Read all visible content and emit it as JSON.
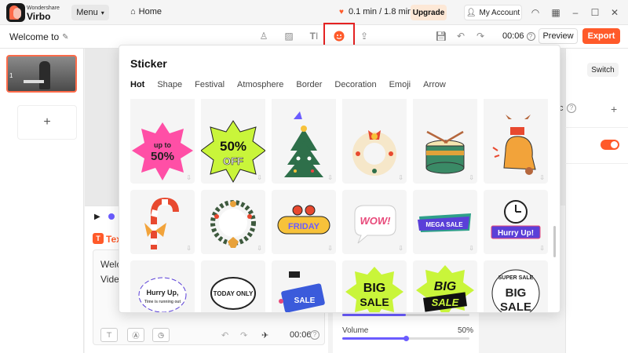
{
  "app": {
    "brand_small": "Wondershare",
    "brand_name": "Virbo",
    "menu_label": "Menu",
    "home_label": "Home",
    "credits": "0.1 min / 1.8 min",
    "upgrade_label": "Upgrade",
    "account_label": "My Account"
  },
  "project": {
    "title": "Welcome to"
  },
  "toolbar": {
    "time": "00:06",
    "preview_label": "Preview",
    "export_label": "Export"
  },
  "slides": [
    {
      "number": "1"
    }
  ],
  "right_panel": {
    "switch_label": "Switch",
    "clipped_text": "c"
  },
  "script": {
    "tab_label": "Tex",
    "line1": "Welco",
    "line2": "Vide",
    "time": "00:06"
  },
  "voice": {
    "volume_label": "Volume",
    "volume_value": "50%",
    "volume_level": 0.5,
    "speed_level": 0.5
  },
  "sticker": {
    "title": "Sticker",
    "tabs": [
      "Hot",
      "Shape",
      "Festival",
      "Atmosphere",
      "Border",
      "Decoration",
      "Emoji",
      "Arrow"
    ],
    "active_tab": "Hot",
    "items": [
      {
        "name": "up-to-50-sticker",
        "l1": "up to",
        "l2": "50%"
      },
      {
        "name": "50-off-sticker",
        "l1": "50%",
        "l2": "OFF"
      },
      {
        "name": "christmas-tree-sticker"
      },
      {
        "name": "christmas-wreath-sticker"
      },
      {
        "name": "drum-sticker"
      },
      {
        "name": "bell-sticker"
      },
      {
        "name": "candy-cane-sticker"
      },
      {
        "name": "floral-wreath-sticker"
      },
      {
        "name": "friday-sticker",
        "l1": "FRIDAY"
      },
      {
        "name": "wow-bubble-sticker",
        "l1": "WOW!"
      },
      {
        "name": "mega-sale-sticker",
        "l1": "MEGA SALE"
      },
      {
        "name": "hurry-up-clock-sticker",
        "l1": "Hurry Up!"
      },
      {
        "name": "hurry-up-circle-sticker",
        "l1": "Hurry Up,",
        "l2": "Time is running out"
      },
      {
        "name": "today-only-sticker",
        "l1": "TODAY ONLY"
      },
      {
        "name": "sale-tag-sticker",
        "l1": "SALE"
      },
      {
        "name": "big-sale-green-sticker",
        "l1": "BIG",
        "l2": "SALE"
      },
      {
        "name": "big-sale-black-sticker",
        "l1": "BIG",
        "l2": "SALE"
      },
      {
        "name": "super-sale-sticker",
        "l1": "SUPER SALE",
        "l2": "BIG",
        "l3": "SALE"
      }
    ]
  }
}
